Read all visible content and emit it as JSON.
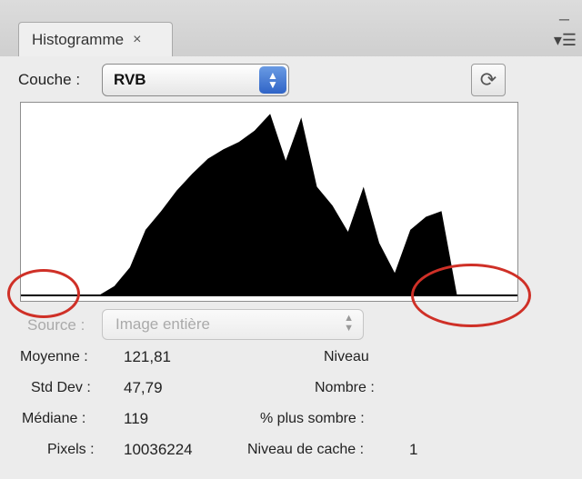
{
  "panel": {
    "tab_label": "Histogramme",
    "tab_close": "×",
    "minimize_icon": "–",
    "menu_icon": "▾☰"
  },
  "channel": {
    "label": "Couche :",
    "value": "RVB"
  },
  "source": {
    "label": "Source :",
    "value": "Image entière"
  },
  "stats": {
    "mean_label": "Moyenne :",
    "mean_value": "121,81",
    "std_label": "Std Dev :",
    "std_value": "47,79",
    "median_label": "Médiane :",
    "median_value": "119",
    "pixels_label": "Pixels :",
    "pixels_value": "10036224",
    "level_label": "Niveau",
    "count_label": "Nombre :",
    "darker_label": "% plus sombre :",
    "cache_label": "Niveau de cache :",
    "cache_value": "1"
  },
  "chart_data": {
    "type": "area",
    "x": [
      0,
      8,
      16,
      24,
      32,
      40,
      48,
      56,
      64,
      72,
      80,
      88,
      96,
      104,
      112,
      120,
      128,
      136,
      144,
      152,
      160,
      168,
      176,
      184,
      192,
      200,
      208,
      216,
      224,
      232,
      240,
      248,
      255
    ],
    "values": [
      0,
      0,
      0,
      0,
      0,
      0,
      5,
      15,
      35,
      45,
      56,
      65,
      73,
      78,
      82,
      88,
      97,
      72,
      95,
      58,
      48,
      34,
      58,
      28,
      12,
      35,
      42,
      45,
      0,
      0,
      0,
      0,
      0
    ],
    "xlim": [
      0,
      255
    ],
    "ylim": [
      0,
      100
    ],
    "fill_color": "#000000",
    "background": "#ffffff"
  },
  "colors": {
    "highlight": "#cf3027"
  }
}
